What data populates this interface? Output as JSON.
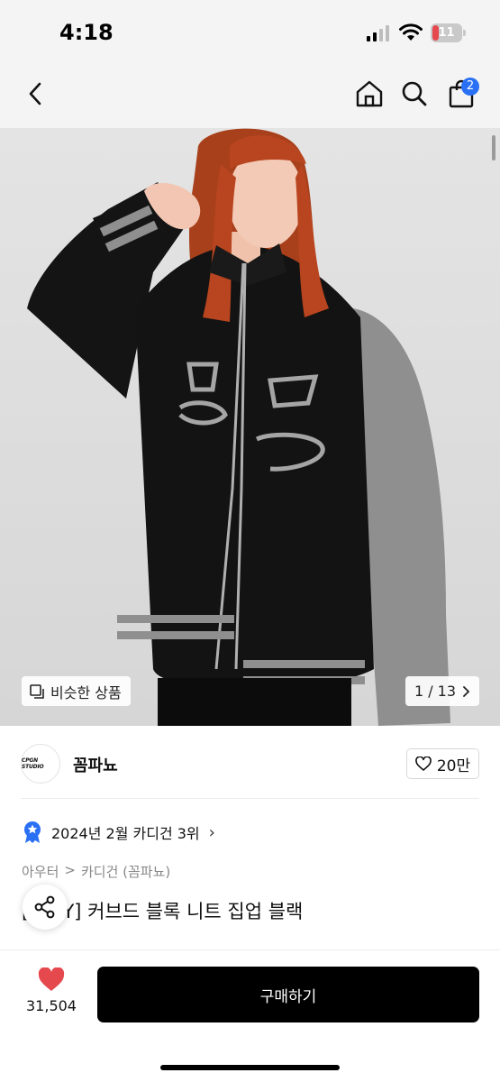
{
  "status_bar": {
    "time": "4:18",
    "battery_level": "11"
  },
  "nav": {
    "cart_count": "2",
    "back_icon": "chevron-left-icon",
    "home_icon": "home-icon",
    "search_icon": "search-icon",
    "cart_icon": "shopping-bag-icon"
  },
  "hero": {
    "similar_label": "비슷한 상품",
    "pager": "1 / 13",
    "sleeve_color": "#8f8f8f",
    "body_color": "#131313",
    "hair_color": "#b8451f"
  },
  "store": {
    "logo_text": "CPGN STUDIO",
    "name": "꼼파뇨",
    "likes": "20만"
  },
  "ranking": {
    "text": "2024년 2월 카디건 3위",
    "chevron": "›"
  },
  "breadcrumb": [
    "아우터",
    ">",
    "카디건 (꼼파뇨)"
  ],
  "product": {
    "title": "[STAY] 커브드 블록 니트 집업 블랙"
  },
  "bottom": {
    "wish_count": "31,504",
    "buy_label": "구매하기",
    "accent_color": "#e5484d"
  }
}
